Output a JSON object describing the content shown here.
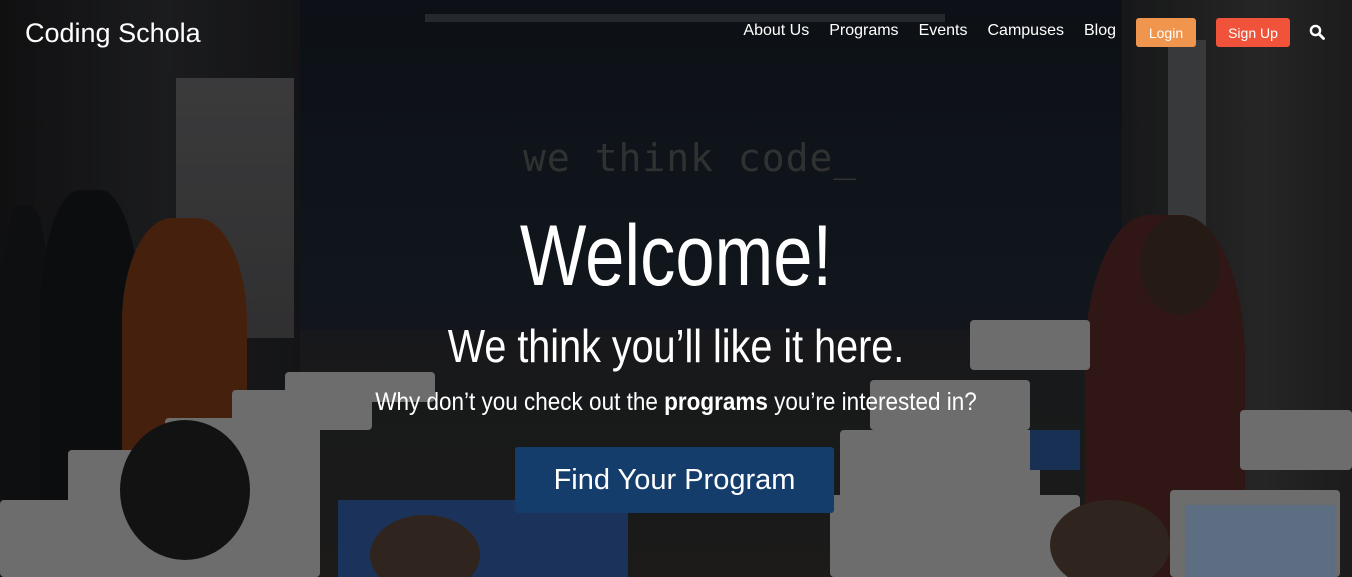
{
  "brand": {
    "name": "Coding Schola"
  },
  "nav": {
    "links": [
      "About Us",
      "Programs",
      "Events",
      "Campuses",
      "Blog"
    ],
    "login_label": "Login",
    "signup_label": "Sign Up",
    "search_icon": "search-icon"
  },
  "hero": {
    "background_wall_text": "we think code_",
    "headline": "Welcome!",
    "subhead": "We think you’ll like it here.",
    "tagline_before": "Why don’t you check out the ",
    "tagline_bold": "programs",
    "tagline_after": " you’re interested in?",
    "cta_label": "Find Your Program"
  },
  "colors": {
    "login_bg": "#f0954e",
    "signup_bg": "#f1533a",
    "cta_bg": "#153d6c",
    "text": "#ffffff"
  }
}
